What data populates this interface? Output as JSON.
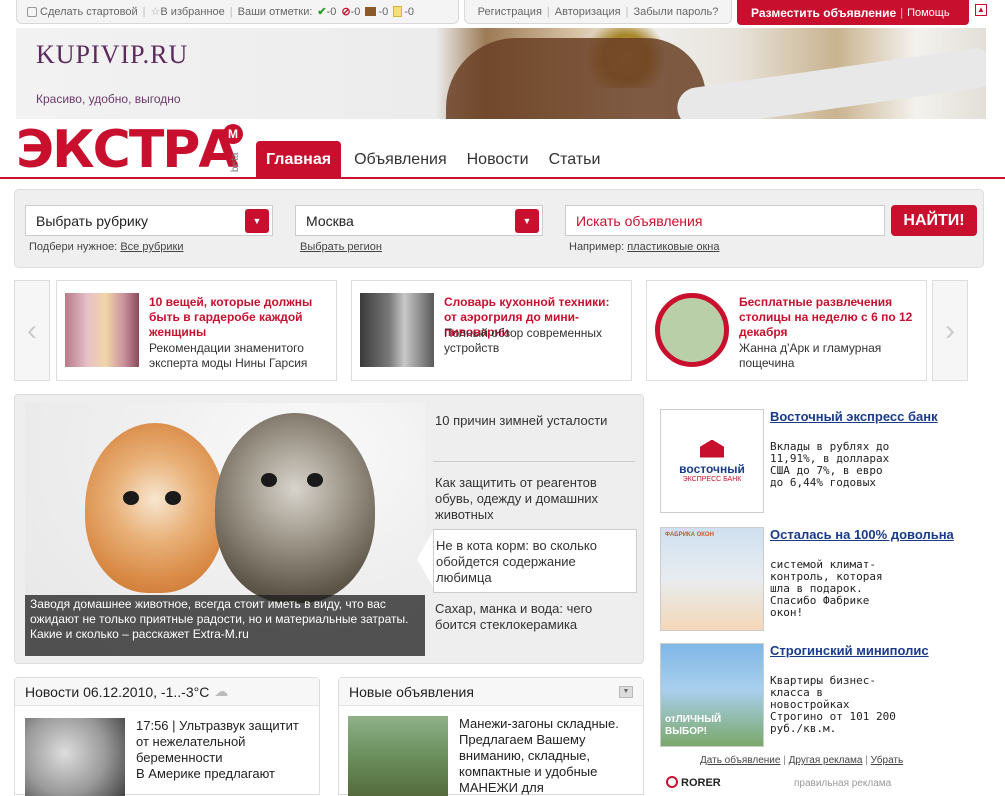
{
  "topbar": {
    "make_start": "Сделать стартовой",
    "favorites": "В избранное",
    "marks_label": "Ваши отметки:",
    "mark_counts": [
      "-0",
      "-0",
      "-0",
      "-0"
    ],
    "register": "Регистрация",
    "login": "Авторизация",
    "forgot": "Забыли пароль?",
    "post_ad": "Разместить объявление",
    "help": "Помощь",
    "colors": {
      "accent": "#c8102e"
    }
  },
  "banner": {
    "brand": "KUPIVIP.RU",
    "slogan": "Красиво, удобно, выгодно"
  },
  "logo": {
    "text": "ЭКСТРА",
    "badge": "М",
    "beta": "beta"
  },
  "nav": [
    {
      "label": "Главная",
      "active": true
    },
    {
      "label": "Объявления"
    },
    {
      "label": "Новости"
    },
    {
      "label": "Статьи"
    }
  ],
  "search": {
    "category_value": "Выбрать рубрику",
    "region_value": "Москва",
    "query_placeholder": "Искать объявления",
    "find_button": "НАЙТИ!",
    "hint1_prefix": "Подбери нужное:",
    "hint1_link": "Все рубрики",
    "hint2_link": "Выбрать регион",
    "hint3_prefix": "Например:",
    "hint3_link": "пластиковые окна"
  },
  "carousel": [
    {
      "title": "10 вещей, которые должны быть в гардеробе каждой женщины",
      "desc": "Рекомендации знаменитого эксперта моды Нины Гарсия"
    },
    {
      "title": "Словарь кухонной техники: от аэрогриля до мини-пивоварни",
      "desc": "Полный обзор современных устройств"
    },
    {
      "title": "Бесплатные развлечения столицы на неделю с 6 по 12 декабря",
      "desc": " Жанна д'Арк и гламурная пощечина"
    }
  ],
  "feature": {
    "caption": "Заводя домашнее животное, всегда стоит иметь в виду, что вас ожидают не только приятные радости, но и материальные затраты. Какие и сколько – расскажет Extra-M.ru",
    "items": [
      "10 причин зимней усталости",
      "Как защитить от реагентов обувь, одежду и домашних животных",
      "Не в кота корм: во сколько обойдется содержание любимца",
      "Сахар, манка и вода: чего боится стеклокерамика"
    ]
  },
  "news": {
    "header": "Новости 06.12.2010, -1..-3°C",
    "time": "17:56",
    "text": "Ультразвук защитит от нежелательной беременности",
    "sub": "В Америке предлагают"
  },
  "new_ads": {
    "header": "Новые объявления",
    "text": "Манежи-загоны складные. Предлагаем Вашему вниманию, складные, компактные и удобные МАНЕЖИ для"
  },
  "side_ads": [
    {
      "title": "Восточный экспресс банк",
      "desc": "Вклады в рублях до 11,91%, в долларах США до 7%, в евро до 6,44% годовых",
      "logo_text": "восточный",
      "logo_sub": "ЭКСПРЕСС БАНК"
    },
    {
      "title": "Осталась на 100% довольна",
      "desc": "системой климат-контроль, которая шла в подарок. Спасибо Фабрике окон!",
      "logo_text": "ФАБРИКА ОКОН"
    },
    {
      "title": "Строгинский миниполис",
      "desc": "Квартиры бизнес-класса в новостройках Строгино от 101 200 руб./кв.м.",
      "img_text": "отЛИЧНЫЙ ВЫБОР!"
    }
  ],
  "side_footer": {
    "give": "Дать объявление",
    "other": "Другая реклама",
    "remove": "Убрать",
    "rorer": "RORER",
    "right": "правильная реклама"
  }
}
